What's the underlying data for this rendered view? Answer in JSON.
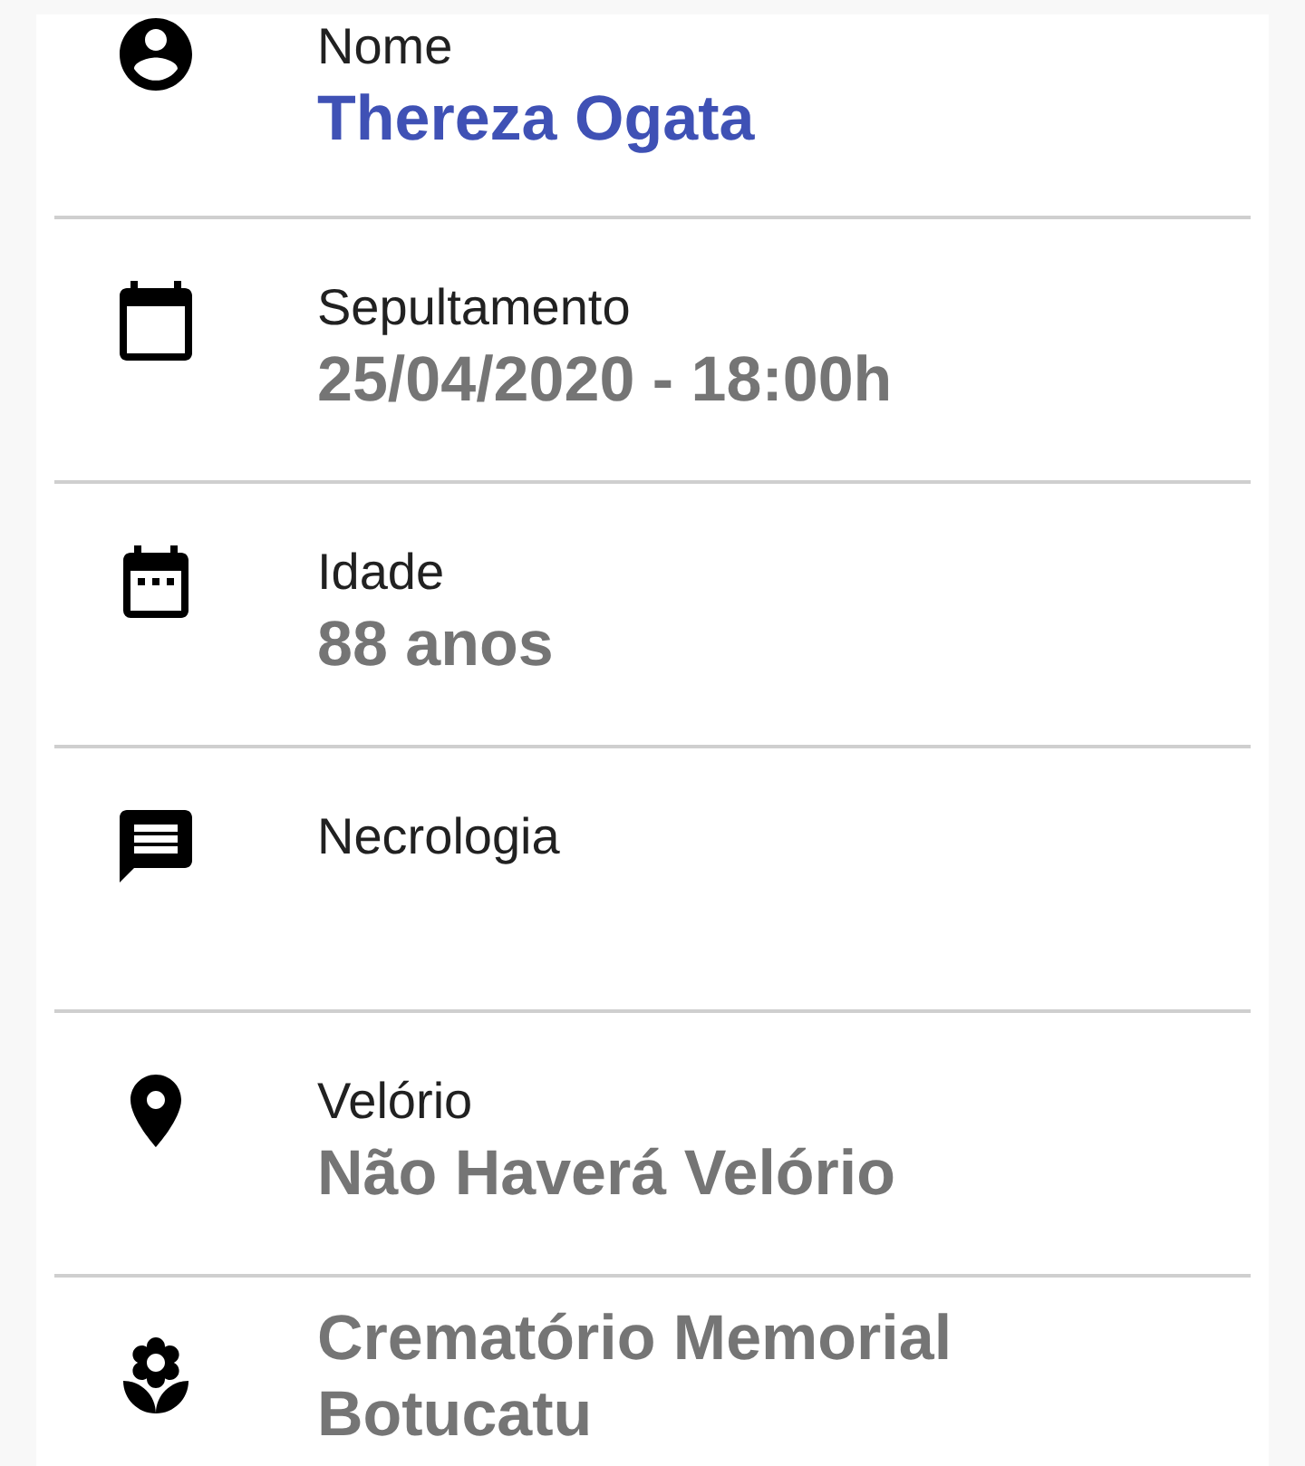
{
  "fields": [
    {
      "kind": "name",
      "label": "Nome",
      "value": "Thereza Ogata"
    },
    {
      "kind": "burial",
      "label": "Sepultamento",
      "value": "25/04/2020 - 18:00h"
    },
    {
      "kind": "age",
      "label": "Idade",
      "value": "88 anos"
    },
    {
      "kind": "obituary",
      "label": "Necrologia"
    },
    {
      "kind": "wake",
      "label": "Velório",
      "value": "Não Haverá Velório"
    },
    {
      "kind": "venue",
      "value": "Crematório Memorial Botucatu"
    }
  ]
}
